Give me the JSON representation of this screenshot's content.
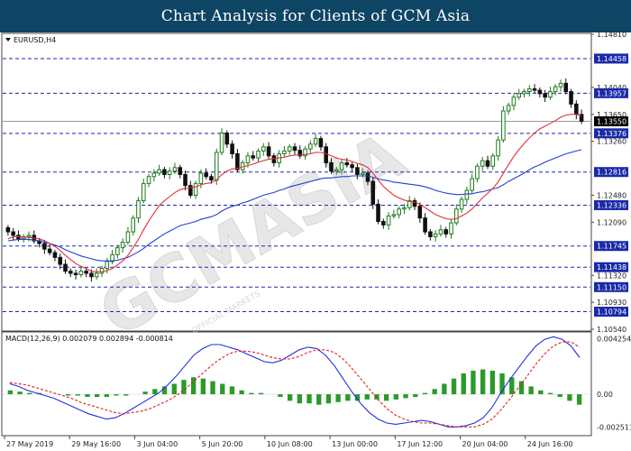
{
  "header": {
    "title": "Chart Analysis for Clients of GCM Asia"
  },
  "main_panel": {
    "symbol_label": "EURUSD,H4"
  },
  "macd_panel": {
    "label": "MACD(12,26,9) 0.002079 0.002894 -0.000814"
  },
  "watermark": {
    "text": "GCMASIA",
    "subtext": "OFFICIAL MARKETS"
  },
  "colors": {
    "header_bg": "#0e4464",
    "candle_bull": "#1e7a1e",
    "candle_bear": "#111111",
    "ma_fast": "#e0303a",
    "ma_slow": "#2040d0",
    "level_line": "#1a2aa8",
    "label_bg": "#1a2aa8",
    "current_bg": "#000000",
    "macd_line": "#2030e0",
    "signal_line": "#e02020",
    "histogram": "#2a9a2a"
  },
  "chart_data": [
    {
      "type": "candlestick",
      "title": "EURUSD,H4",
      "ylim": [
        1.1054,
        1.1481
      ],
      "y_ticks": [
        "1.14810",
        "1.14040",
        "1.13650",
        "1.13260",
        "1.12480",
        "1.12090",
        "1.11320",
        "1.10930",
        "1.10540"
      ],
      "x_ticks": [
        "27 May 2019",
        "29 May 16:00",
        "3 Jun 04:00",
        "5 Jun 20:00",
        "10 Jun 08:00",
        "13 Jun 00:00",
        "17 Jun 12:00",
        "20 Jun 04:00",
        "24 Jun 16:00"
      ],
      "levels": [
        {
          "value": 1.14458,
          "label": "1.14458"
        },
        {
          "value": 1.13957,
          "label": "1.13957"
        },
        {
          "value": 1.13376,
          "label": "1.13376"
        },
        {
          "value": 1.12816,
          "label": "1.12816"
        },
        {
          "value": 1.12336,
          "label": "1.12336"
        },
        {
          "value": 1.11745,
          "label": "1.11745"
        },
        {
          "value": 1.11438,
          "label": "1.11438"
        },
        {
          "value": 1.1115,
          "label": "1.11150"
        },
        {
          "value": 1.10794,
          "label": "1.10794"
        }
      ],
      "current_price": {
        "value": 1.1355,
        "label": "1.13550"
      },
      "close": [
        1.1195,
        1.119,
        1.1185,
        1.1188,
        1.119,
        1.1182,
        1.1178,
        1.117,
        1.1165,
        1.1158,
        1.1148,
        1.1138,
        1.1135,
        1.1133,
        1.1138,
        1.1135,
        1.113,
        1.1135,
        1.1142,
        1.1152,
        1.1162,
        1.1172,
        1.118,
        1.1195,
        1.1215,
        1.124,
        1.1265,
        1.1275,
        1.128,
        1.1285,
        1.1278,
        1.1283,
        1.1288,
        1.1278,
        1.1262,
        1.1248,
        1.1265,
        1.128,
        1.1275,
        1.127,
        1.131,
        1.1338,
        1.1322,
        1.1308,
        1.1285,
        1.1295,
        1.1305,
        1.1302,
        1.1312,
        1.1318,
        1.1305,
        1.1295,
        1.1308,
        1.1312,
        1.1318,
        1.1313,
        1.1305,
        1.1315,
        1.1322,
        1.133,
        1.1318,
        1.1295,
        1.1283,
        1.1285,
        1.1295,
        1.1292,
        1.1288,
        1.1278,
        1.128,
        1.1268,
        1.1235,
        1.121,
        1.1205,
        1.1218,
        1.122,
        1.1228,
        1.123,
        1.124,
        1.1232,
        1.1215,
        1.1195,
        1.1188,
        1.1192,
        1.1198,
        1.1192,
        1.1208,
        1.1228,
        1.1242,
        1.1255,
        1.1272,
        1.129,
        1.1298,
        1.129,
        1.1305,
        1.1328,
        1.137,
        1.1378,
        1.139,
        1.1395,
        1.1398,
        1.1402,
        1.14,
        1.1395,
        1.139,
        1.1398,
        1.1405,
        1.141,
        1.1398,
        1.138,
        1.1365,
        1.1355
      ],
      "ma_fast": [
        1.1185,
        1.1188,
        1.1188,
        1.1187,
        1.1187,
        1.1186,
        1.1185,
        1.1182,
        1.1178,
        1.1174,
        1.1168,
        1.1161,
        1.1155,
        1.1149,
        1.1145,
        1.1142,
        1.1138,
        1.1137,
        1.1137,
        1.1139,
        1.1142,
        1.1147,
        1.1153,
        1.1161,
        1.1172,
        1.1184,
        1.1198,
        1.1211,
        1.1222,
        1.1233,
        1.124,
        1.1246,
        1.1252,
        1.1256,
        1.1258,
        1.1259,
        1.126,
        1.1263,
        1.1265,
        1.1266,
        1.127,
        1.1278,
        1.1283,
        1.1286,
        1.1287,
        1.1289,
        1.1291,
        1.1293,
        1.1296,
        1.1298,
        1.13,
        1.1301,
        1.1302,
        1.1303,
        1.1305,
        1.1306,
        1.1306,
        1.1307,
        1.1308,
        1.131,
        1.131,
        1.1308,
        1.1305,
        1.1302,
        1.13,
        1.1299,
        1.1297,
        1.1294,
        1.1292,
        1.1288,
        1.128,
        1.127,
        1.1261,
        1.1254,
        1.1248,
        1.1244,
        1.1241,
        1.1239,
        1.1238,
        1.1235,
        1.123,
        1.1225,
        1.122,
        1.1217,
        1.1214,
        1.1213,
        1.1214,
        1.1218,
        1.1222,
        1.1228,
        1.1236,
        1.1244,
        1.1251,
        1.1258,
        1.1267,
        1.128,
        1.1292,
        1.1304,
        1.1314,
        1.1323,
        1.1331,
        1.1338,
        1.1344,
        1.1348,
        1.1352,
        1.1356,
        1.1361,
        1.1364,
        1.1365,
        1.1365,
        1.1363
      ],
      "ma_slow": [
        1.1182,
        1.1183,
        1.1184,
        1.1184,
        1.1184,
        1.1183,
        1.1182,
        1.118,
        1.1178,
        1.1176,
        1.1173,
        1.1169,
        1.1166,
        1.1163,
        1.116,
        1.1158,
        1.1156,
        1.1154,
        1.1153,
        1.1153,
        1.1153,
        1.1154,
        1.1156,
        1.1158,
        1.1162,
        1.1166,
        1.1171,
        1.1177,
        1.1182,
        1.1187,
        1.1192,
        1.1196,
        1.12,
        1.1204,
        1.1206,
        1.1208,
        1.121,
        1.1213,
        1.1215,
        1.1217,
        1.122,
        1.1225,
        1.1229,
        1.1232,
        1.1234,
        1.1237,
        1.1239,
        1.1242,
        1.1245,
        1.1248,
        1.125,
        1.1252,
        1.1255,
        1.1257,
        1.126,
        1.1262,
        1.1264,
        1.1266,
        1.1268,
        1.127,
        1.1272,
        1.1273,
        1.1273,
        1.1274,
        1.1275,
        1.1275,
        1.1276,
        1.1276,
        1.1276,
        1.1276,
        1.1274,
        1.1272,
        1.127,
        1.1269,
        1.1267,
        1.1266,
        1.1265,
        1.1264,
        1.1263,
        1.1262,
        1.126,
        1.1258,
        1.1255,
        1.1253,
        1.1251,
        1.125,
        1.1249,
        1.1249,
        1.125,
        1.125,
        1.1252,
        1.1253,
        1.1255,
        1.1257,
        1.1259,
        1.1263,
        1.1268,
        1.1272,
        1.1276,
        1.128,
        1.1285,
        1.1289,
        1.1292,
        1.1296,
        1.1299,
        1.1302,
        1.1305,
        1.1308,
        1.131,
        1.1312,
        1.1314
      ]
    },
    {
      "type": "macd",
      "title": "MACD(12,26,9) 0.002079 0.002894 -0.000814",
      "params": "12,26,9",
      "ylim": [
        -0.0031,
        0.0047
      ],
      "y_ticks": [
        "0.004254",
        "0.00",
        "-0.002511"
      ],
      "values": {
        "macd": 0.002079,
        "signal": 0.002894,
        "histogram": -0.000814
      },
      "macd_line": [
        0.0008,
        0.0006,
        0.0003,
        0.0001,
        -0.0001,
        -0.0003,
        -0.0006,
        -0.0009,
        -0.0012,
        -0.0015,
        -0.0017,
        -0.0019,
        -0.0018,
        -0.0015,
        -0.0011,
        -0.0007,
        -0.0003,
        0.0001,
        0.0007,
        0.0014,
        0.0022,
        0.003,
        0.0035,
        0.0038,
        0.0038,
        0.0036,
        0.0034,
        0.0031,
        0.0028,
        0.0025,
        0.0024,
        0.0026,
        0.003,
        0.0034,
        0.0036,
        0.0035,
        0.003,
        0.0022,
        0.0012,
        0.0002,
        -0.0007,
        -0.0014,
        -0.0019,
        -0.0022,
        -0.0023,
        -0.0022,
        -0.0021,
        -0.002,
        -0.0021,
        -0.0023,
        -0.0025,
        -0.0025,
        -0.0024,
        -0.0022,
        -0.0018,
        -0.001,
        0.0001,
        0.0011,
        0.002,
        0.0029,
        0.0037,
        0.0042,
        0.0044,
        0.0042,
        0.0037,
        0.0028
      ],
      "signal_line": [
        0.0009,
        0.0008,
        0.0007,
        0.0005,
        0.0003,
        0.0001,
        -0.0001,
        -0.0003,
        -0.0006,
        -0.0008,
        -0.001,
        -0.0012,
        -0.0014,
        -0.0015,
        -0.0014,
        -0.0013,
        -0.0011,
        -0.0008,
        -0.0005,
        -0.0001,
        0.0004,
        0.001,
        0.0016,
        0.0022,
        0.0027,
        0.0031,
        0.0033,
        0.0033,
        0.0032,
        0.003,
        0.0028,
        0.0027,
        0.0027,
        0.0029,
        0.0032,
        0.0034,
        0.0034,
        0.0032,
        0.0027,
        0.002,
        0.0012,
        0.0004,
        -0.0004,
        -0.0011,
        -0.0016,
        -0.0019,
        -0.0021,
        -0.0022,
        -0.0022,
        -0.0023,
        -0.0024,
        -0.0025,
        -0.0025,
        -0.0025,
        -0.0023,
        -0.0019,
        -0.0012,
        -0.0004,
        0.0005,
        0.0014,
        0.0023,
        0.0031,
        0.0037,
        0.004,
        0.004,
        0.0036
      ],
      "histogram": [
        0.0003,
        0.0002,
        0.0001,
        0.0001,
        0.0,
        0.0,
        -0.0001,
        -0.0001,
        -0.0002,
        -0.0002,
        -0.0002,
        -0.0001,
        -0.0001,
        0.0,
        0.0002,
        0.0004,
        0.0006,
        0.0008,
        0.0011,
        0.0013,
        0.0012,
        0.001,
        0.0008,
        0.0006,
        0.0003,
        0.0001,
        0.0001,
        0.0,
        -0.0002,
        -0.0005,
        -0.0007,
        -0.0007,
        -0.0008,
        -0.0007,
        -0.0006,
        -0.0005,
        -0.0005,
        -0.0004,
        -0.0004,
        -0.0005,
        -0.0004,
        -0.0003,
        -0.0002,
        0.0001,
        0.0004,
        0.0008,
        0.0012,
        0.0016,
        0.0018,
        0.0019,
        0.0018,
        0.0016,
        0.0013,
        0.001,
        0.0006,
        0.0003,
        0.0001,
        -0.0002,
        -0.0005,
        -0.0008
      ]
    }
  ]
}
